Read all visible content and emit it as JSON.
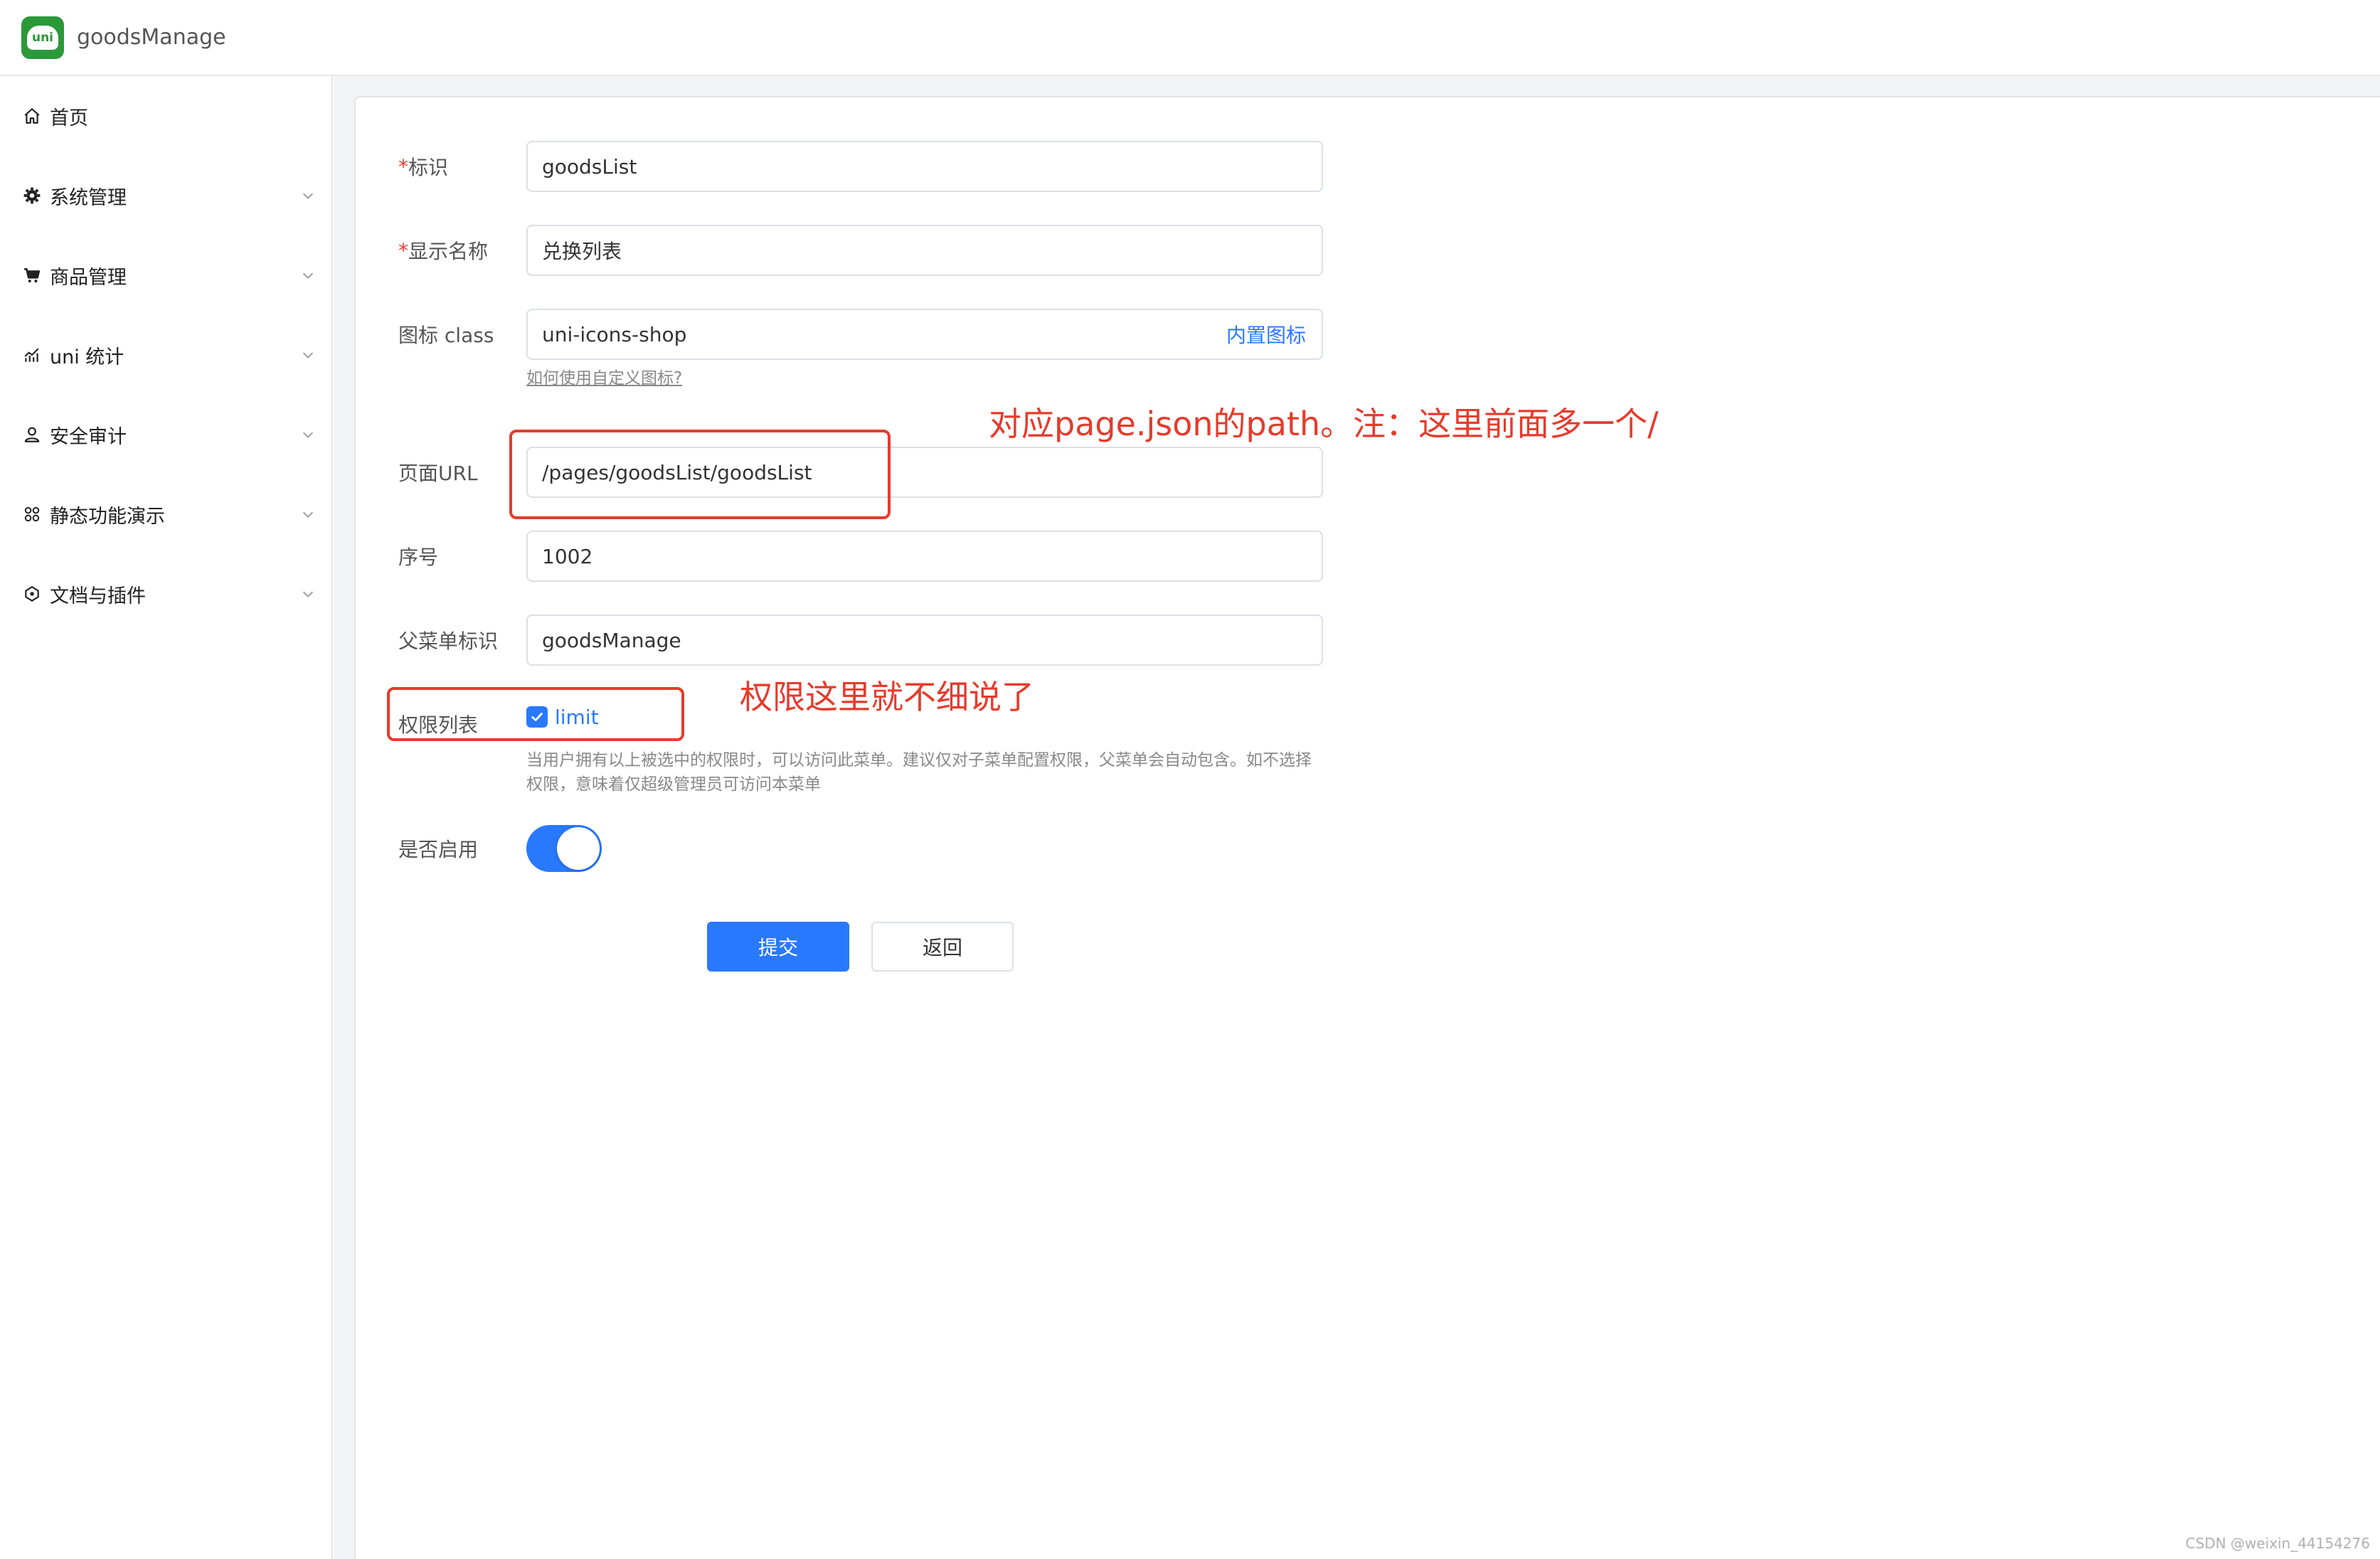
{
  "app": {
    "title": "goodsManage",
    "logo_text": "uni",
    "brand_color": "#2b9939",
    "accent_color": "#2979ff"
  },
  "sidebar": {
    "items": [
      {
        "label": "首页",
        "icon": "home-icon",
        "expandable": false
      },
      {
        "label": "系统管理",
        "icon": "gear-icon",
        "expandable": true
      },
      {
        "label": "商品管理",
        "icon": "cart-icon",
        "expandable": true
      },
      {
        "label": "uni 统计",
        "icon": "chart-icon",
        "expandable": true
      },
      {
        "label": "安全审计",
        "icon": "user-icon",
        "expandable": true
      },
      {
        "label": "静态功能演示",
        "icon": "grid-icon",
        "expandable": true
      },
      {
        "label": "文档与插件",
        "icon": "plugin-icon",
        "expandable": true
      }
    ]
  },
  "form": {
    "id_label": "标识",
    "id_value": "goodsList",
    "name_label": "显示名称",
    "name_value": "兑换列表",
    "icon_label": "图标 class",
    "icon_value": "uni-icons-shop",
    "icon_builtin_link": "内置图标",
    "icon_help_link": "如何使用自定义图标?",
    "url_label": "页面URL",
    "url_value": "/pages/goodsList/goodsList",
    "order_label": "序号",
    "order_value": "1002",
    "parent_label": "父菜单标识",
    "parent_value": "goodsManage",
    "perm_label": "权限列表",
    "perm_option": "limit",
    "perm_checked": true,
    "perm_hint": "当用户拥有以上被选中的权限时，可以访问此菜单。建议仅对子菜单配置权限，父菜单会自动包含。如不选择权限，意味着仅超级管理员可访问本菜单",
    "enabled_label": "是否启用",
    "enabled": true,
    "submit_label": "提交",
    "back_label": "返回",
    "required_mark": "*"
  },
  "annotations": {
    "url_note": "对应page.json的path。注：这里前面多一个/",
    "perm_note": "权限这里就不细说了",
    "color": "#e53b2c"
  },
  "watermark": "CSDN @weixin_44154276"
}
